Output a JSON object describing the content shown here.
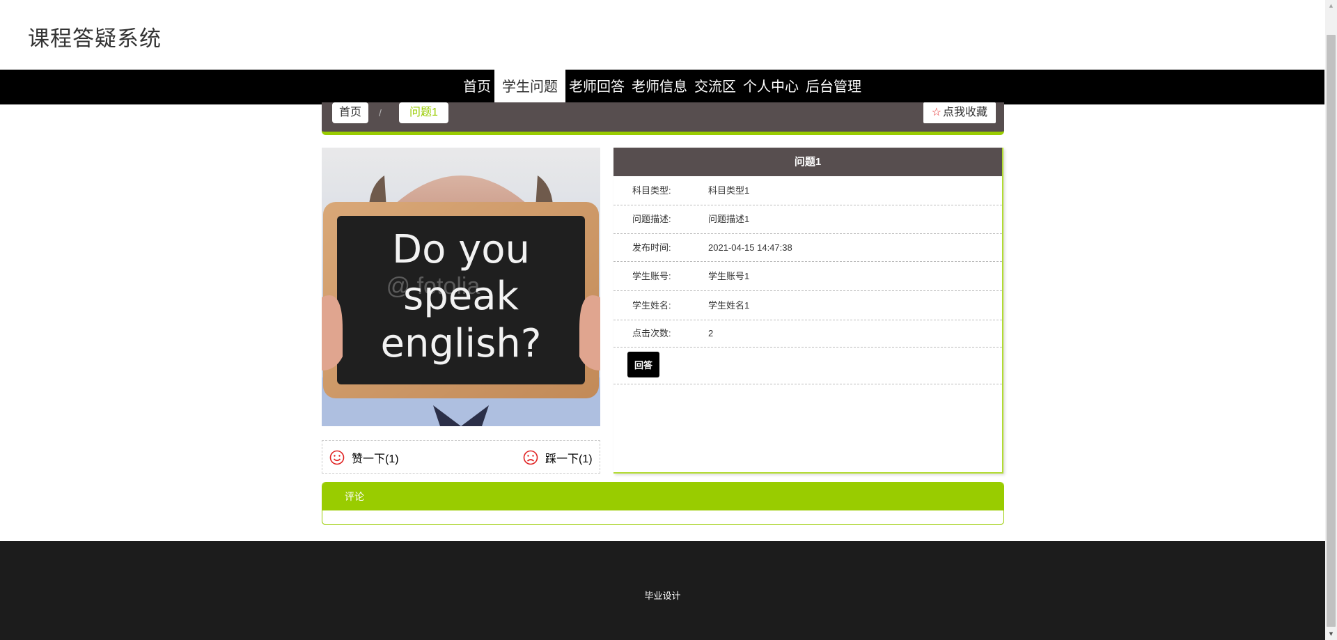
{
  "header": {
    "site_title": "课程答疑系统"
  },
  "nav": {
    "items": [
      "首页",
      "学生问题",
      "老师回答",
      "老师信息",
      "交流区",
      "个人中心",
      "后台管理"
    ],
    "active_index": 1
  },
  "breadcrumb": {
    "home": "首页",
    "separator": "/",
    "current": "问题1"
  },
  "favorite": {
    "icon": "star-icon",
    "label": "点我收藏"
  },
  "image": {
    "board_lines": [
      "Do you",
      "speak",
      "english?"
    ],
    "watermark": "@ fotolia"
  },
  "vote": {
    "like_label": "赞一下(1)",
    "dislike_label": "踩一下(1)",
    "like_icon": "smile-icon",
    "dislike_icon": "frown-icon"
  },
  "detail": {
    "title": "问题1",
    "rows": [
      {
        "label": "科目类型:",
        "value": "科目类型1"
      },
      {
        "label": "问题描述:",
        "value": "问题描述1"
      },
      {
        "label": "发布时间:",
        "value": "2021-04-15 14:47:38"
      },
      {
        "label": "学生账号:",
        "value": "学生账号1"
      },
      {
        "label": "学生姓名:",
        "value": "学生姓名1"
      },
      {
        "label": "点击次数:",
        "value": "2"
      }
    ],
    "answer_button": "回答"
  },
  "comments": {
    "title": "评论"
  },
  "footer": {
    "text": "毕业设计"
  },
  "colors": {
    "accent": "#99cc00",
    "dark": "#574e4f",
    "nav_bg": "#000000",
    "footer_bg": "#1c1c1c"
  }
}
